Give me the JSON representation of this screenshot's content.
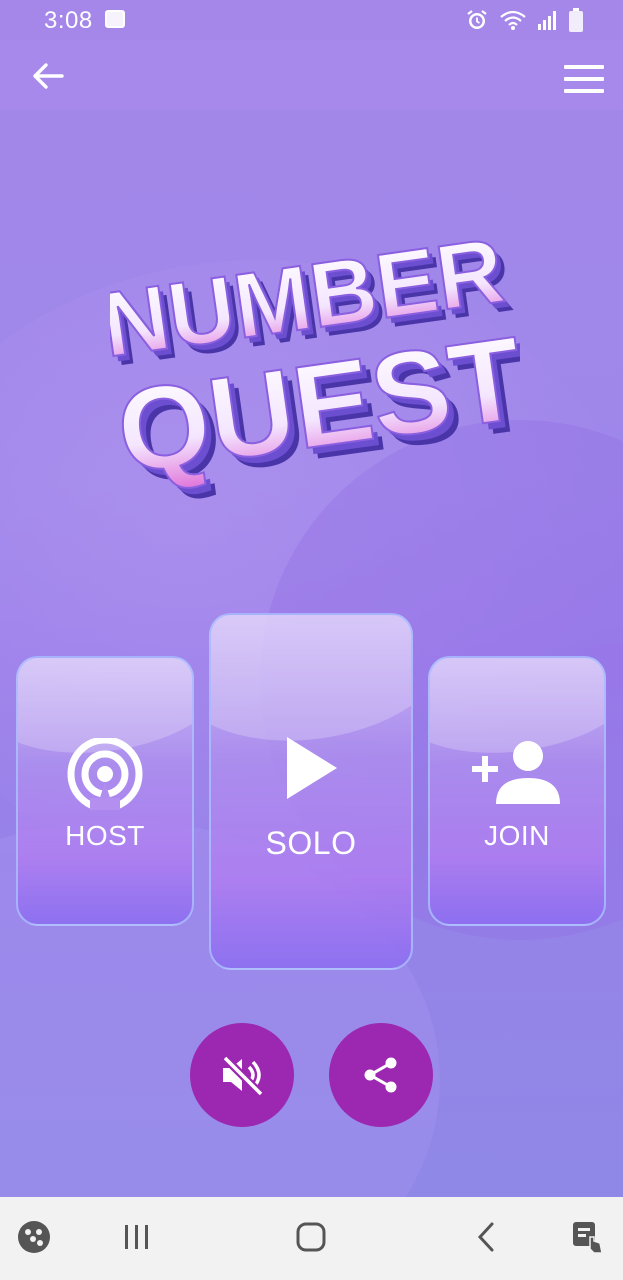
{
  "status_bar": {
    "time": "3:08",
    "icons": [
      "image-icon",
      "alarm-icon",
      "wifi-icon",
      "signal-icon",
      "battery-icon"
    ]
  },
  "top_bar": {
    "back_icon": "arrow-left-icon",
    "menu_icon": "hamburger-menu-icon"
  },
  "logo": {
    "line1": "NUMBER",
    "line2": "QUEST"
  },
  "modes": [
    {
      "label": "HOST",
      "icon": "broadcast-icon"
    },
    {
      "label": "SOLO",
      "icon": "play-icon"
    },
    {
      "label": "JOIN",
      "icon": "add-person-icon"
    }
  ],
  "actions": {
    "mute_icon": "volume-off-icon",
    "share_icon": "share-icon"
  },
  "nav_bar": {
    "items": [
      "game-launcher-icon",
      "recent-apps-icon",
      "home-icon",
      "back-icon",
      "accessibility-icon"
    ]
  },
  "colors": {
    "background": "#9e87ea",
    "accent_button": "#9c27b0",
    "card_border": "#aabeff",
    "text": "#ffffff"
  }
}
